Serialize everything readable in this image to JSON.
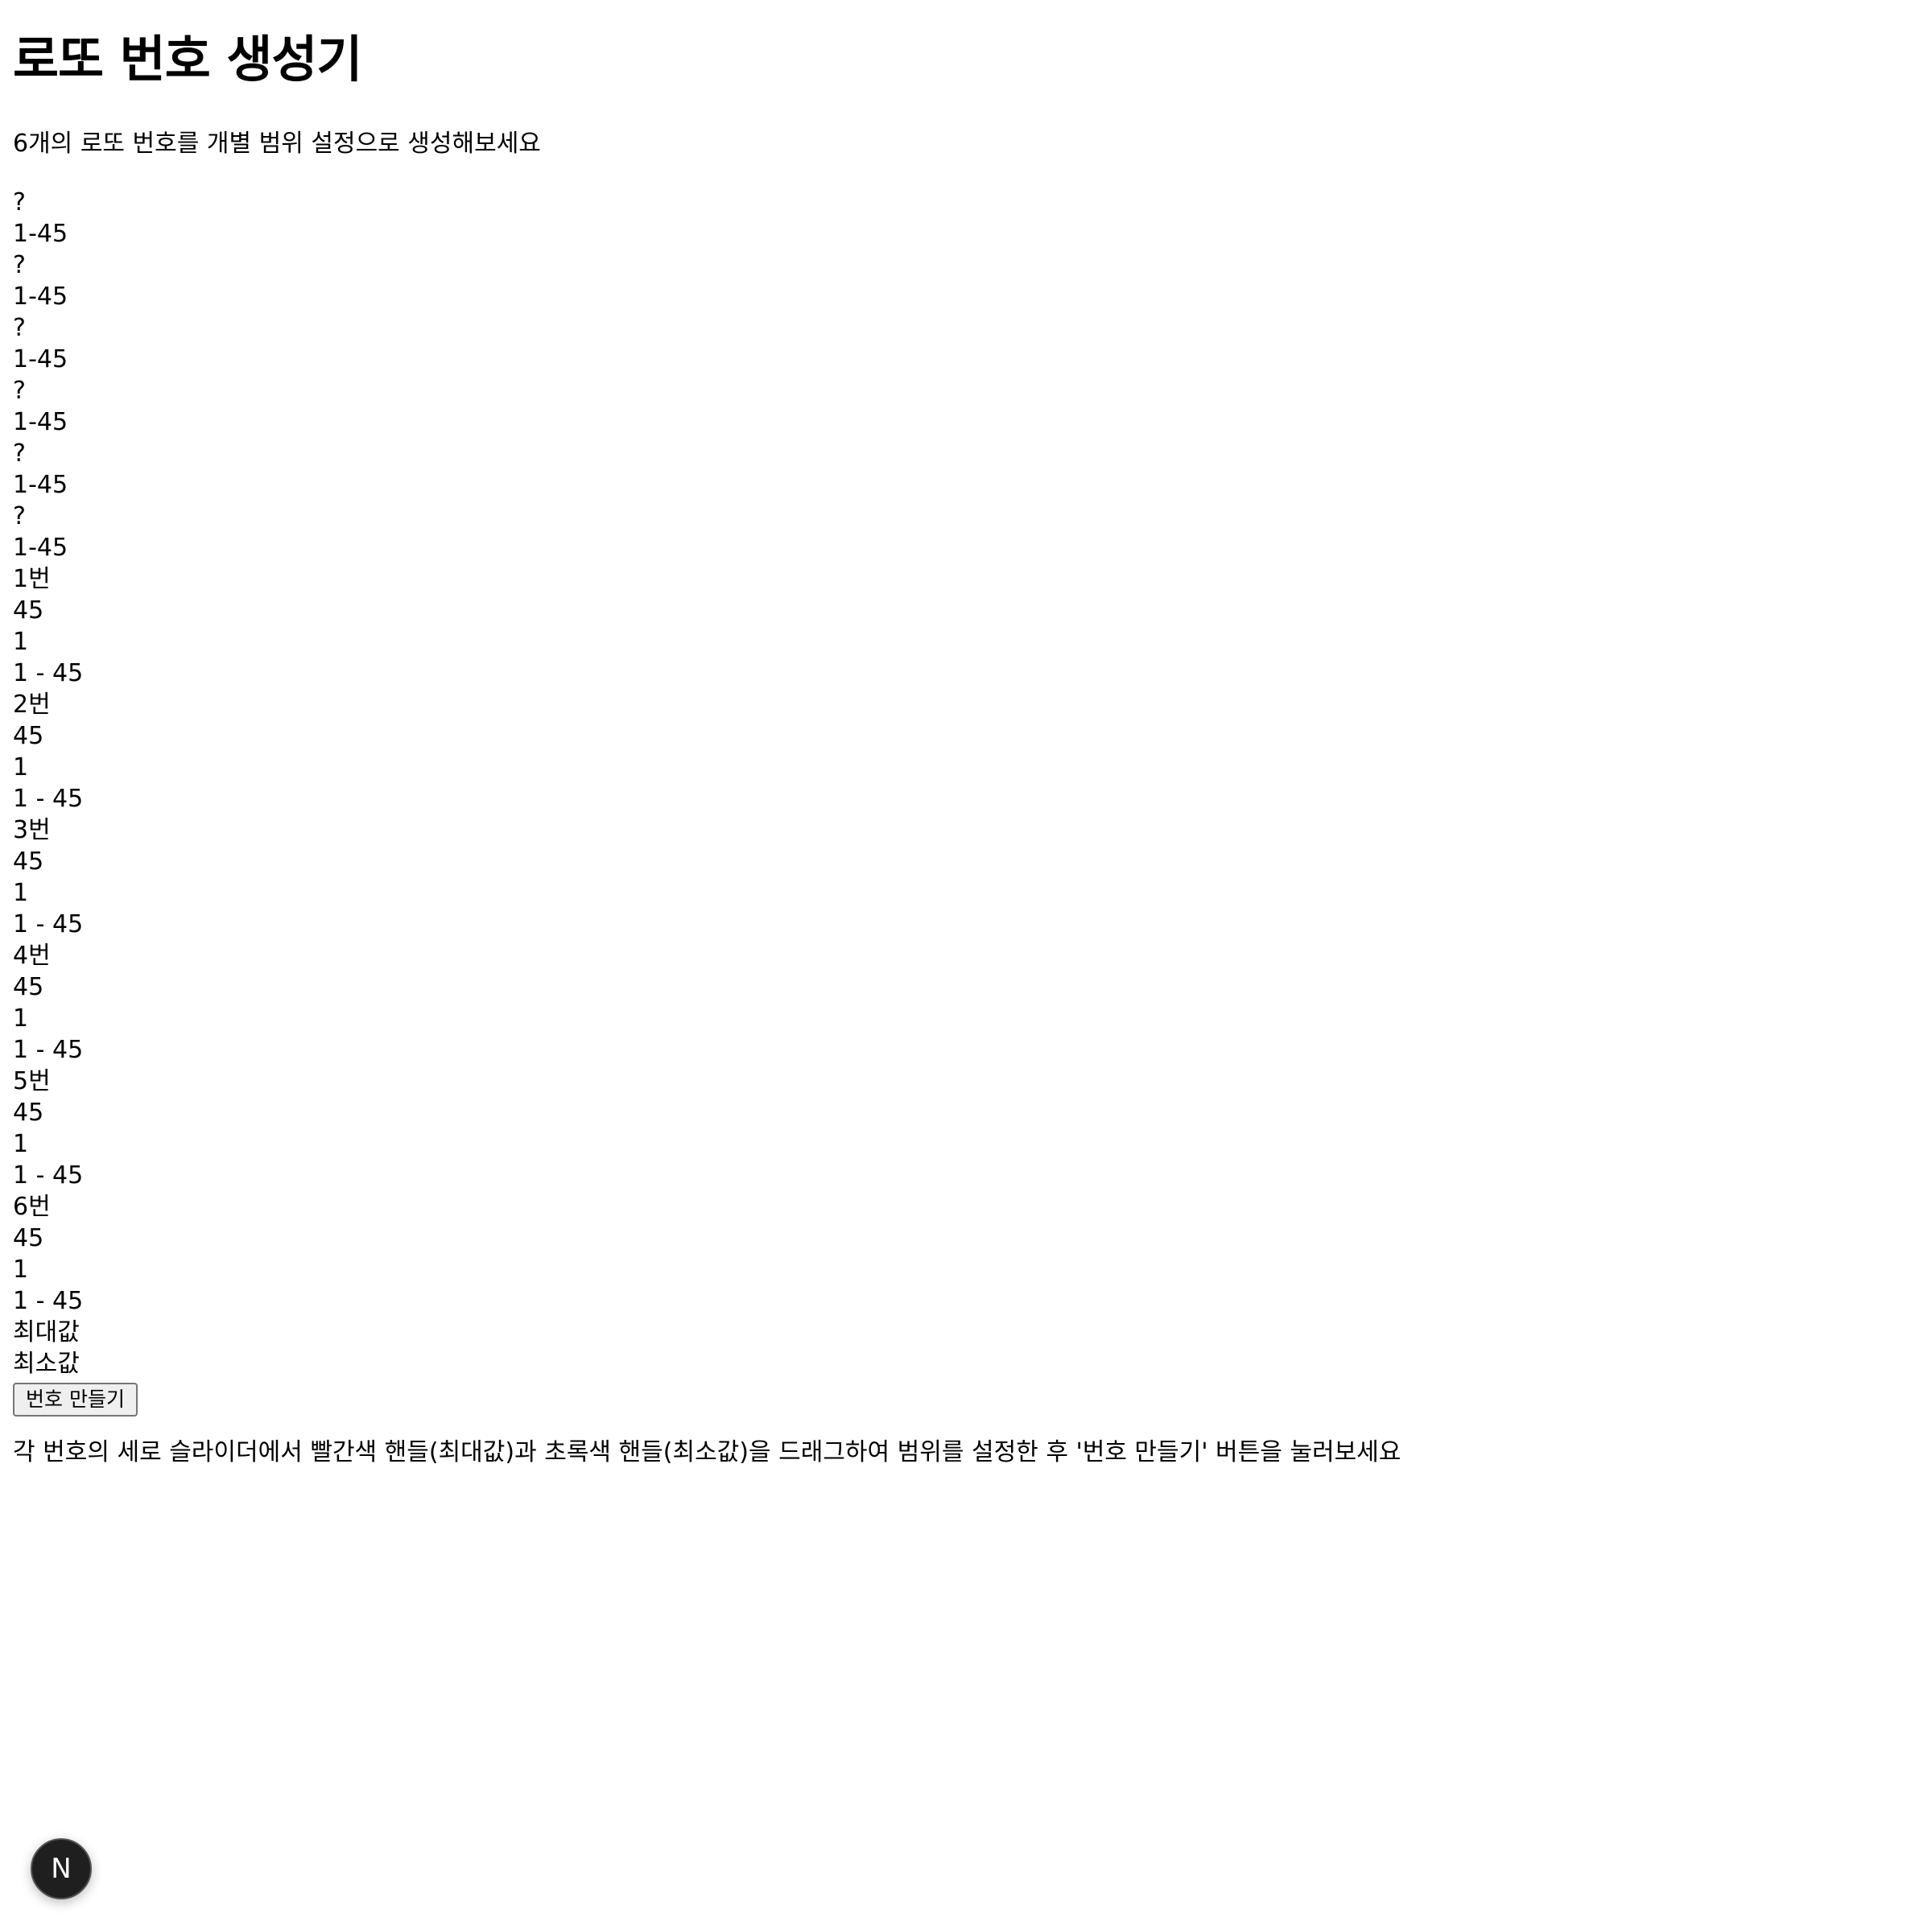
{
  "header": {
    "title": "로또 번호 생성기",
    "subtitle": "6개의 로또 번호를 개별 범위 설정으로 생성해보세요"
  },
  "balls": [
    {
      "value": "?",
      "range": "1-45"
    },
    {
      "value": "?",
      "range": "1-45"
    },
    {
      "value": "?",
      "range": "1-45"
    },
    {
      "value": "?",
      "range": "1-45"
    },
    {
      "value": "?",
      "range": "1-45"
    },
    {
      "value": "?",
      "range": "1-45"
    }
  ],
  "sliders": [
    {
      "label": "1번",
      "max": "45",
      "min": "1",
      "range": "1 - 45"
    },
    {
      "label": "2번",
      "max": "45",
      "min": "1",
      "range": "1 - 45"
    },
    {
      "label": "3번",
      "max": "45",
      "min": "1",
      "range": "1 - 45"
    },
    {
      "label": "4번",
      "max": "45",
      "min": "1",
      "range": "1 - 45"
    },
    {
      "label": "5번",
      "max": "45",
      "min": "1",
      "range": "1 - 45"
    },
    {
      "label": "6번",
      "max": "45",
      "min": "1",
      "range": "1 - 45"
    }
  ],
  "legend": {
    "max_label": "최대값",
    "min_label": "최소값"
  },
  "actions": {
    "generate_label": "번호 만들기"
  },
  "footer": {
    "instruction": "각 번호의 세로 슬라이더에서 빨간색 핸들(최대값)과 초록색 핸들(최소값)을 드래그하여 범위를 설정한 후 '번호 만들기' 버튼을 눌러보세요"
  },
  "dev_badge": {
    "letter": "N",
    "icon": "nextjs-icon"
  }
}
